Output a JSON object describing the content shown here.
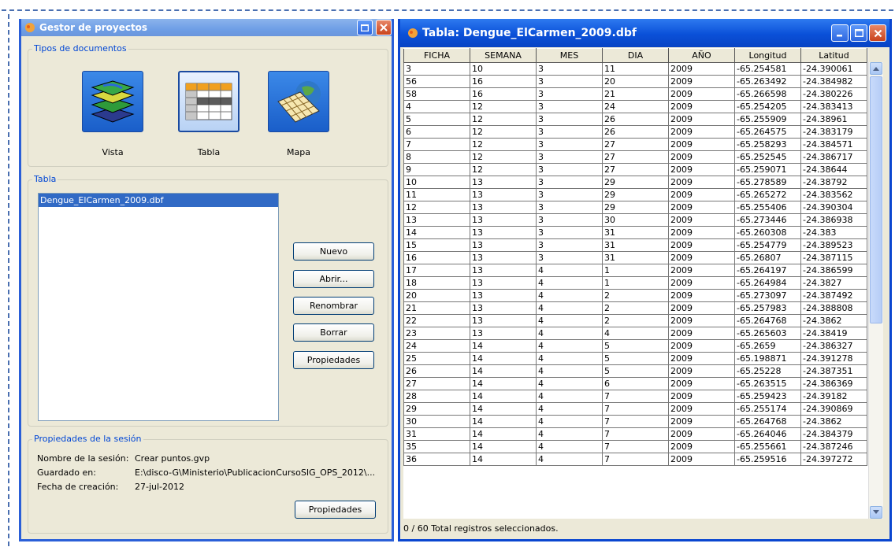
{
  "left_window": {
    "title": "Gestor de proyectos",
    "doc_types_legend": "Tipos de documentos",
    "doc_types": [
      {
        "label": "Vista",
        "icon": "vista-layers-icon"
      },
      {
        "label": "Tabla",
        "icon": "table-icon"
      },
      {
        "label": "Mapa",
        "icon": "map-icon"
      }
    ],
    "table_legend": "Tabla",
    "table_items": [
      "Dengue_ElCarmen_2009.dbf"
    ],
    "buttons": {
      "new": "Nuevo",
      "open": "Abrir...",
      "rename": "Renombrar",
      "delete": "Borrar",
      "properties": "Propiedades"
    },
    "session": {
      "legend": "Propiedades de la sesión",
      "name_label": "Nombre de la sesión:",
      "name_value": "Crear puntos.gvp",
      "saved_label": "Guardado en:",
      "saved_value": "E:\\disco-G\\Ministerio\\PublicacionCursoSIG_OPS_2012\\...",
      "date_label": "Fecha de creación:",
      "date_value": "27-jul-2012",
      "properties_button": "Propiedades"
    }
  },
  "right_window": {
    "title": "Tabla: Dengue_ElCarmen_2009.dbf",
    "columns": [
      "FICHA",
      "SEMANA",
      "MES",
      "DIA",
      "AÑO",
      "Longitud",
      "Latitud"
    ],
    "rows": [
      [
        "3",
        "10",
        "3",
        "11",
        "2009",
        "-65.254581",
        "-24.390061"
      ],
      [
        "56",
        "16",
        "3",
        "20",
        "2009",
        "-65.263492",
        "-24.384982"
      ],
      [
        "58",
        "16",
        "3",
        "21",
        "2009",
        "-65.266598",
        "-24.380226"
      ],
      [
        "4",
        "12",
        "3",
        "24",
        "2009",
        "-65.254205",
        "-24.383413"
      ],
      [
        "5",
        "12",
        "3",
        "26",
        "2009",
        "-65.255909",
        "-24.38961"
      ],
      [
        "6",
        "12",
        "3",
        "26",
        "2009",
        "-65.264575",
        "-24.383179"
      ],
      [
        "7",
        "12",
        "3",
        "27",
        "2009",
        "-65.258293",
        "-24.384571"
      ],
      [
        "8",
        "12",
        "3",
        "27",
        "2009",
        "-65.252545",
        "-24.386717"
      ],
      [
        "9",
        "12",
        "3",
        "27",
        "2009",
        "-65.259071",
        "-24.38644"
      ],
      [
        "10",
        "13",
        "3",
        "29",
        "2009",
        "-65.278589",
        "-24.38792"
      ],
      [
        "11",
        "13",
        "3",
        "29",
        "2009",
        "-65.265272",
        "-24.383562"
      ],
      [
        "12",
        "13",
        "3",
        "29",
        "2009",
        "-65.255406",
        "-24.390304"
      ],
      [
        "13",
        "13",
        "3",
        "30",
        "2009",
        "-65.273446",
        "-24.386938"
      ],
      [
        "14",
        "13",
        "3",
        "31",
        "2009",
        "-65.260308",
        "-24.383"
      ],
      [
        "15",
        "13",
        "3",
        "31",
        "2009",
        "-65.254779",
        "-24.389523"
      ],
      [
        "16",
        "13",
        "3",
        "31",
        "2009",
        "-65.26807",
        "-24.387115"
      ],
      [
        "17",
        "13",
        "4",
        "1",
        "2009",
        "-65.264197",
        "-24.386599"
      ],
      [
        "18",
        "13",
        "4",
        "1",
        "2009",
        "-65.264984",
        "-24.3827"
      ],
      [
        "20",
        "13",
        "4",
        "2",
        "2009",
        "-65.273097",
        "-24.387492"
      ],
      [
        "21",
        "13",
        "4",
        "2",
        "2009",
        "-65.257983",
        "-24.388808"
      ],
      [
        "22",
        "13",
        "4",
        "2",
        "2009",
        "-65.264768",
        "-24.3862"
      ],
      [
        "23",
        "13",
        "4",
        "4",
        "2009",
        "-65.265603",
        "-24.38419"
      ],
      [
        "24",
        "14",
        "4",
        "5",
        "2009",
        "-65.2659",
        "-24.386327"
      ],
      [
        "25",
        "14",
        "4",
        "5",
        "2009",
        "-65.198871",
        "-24.391278"
      ],
      [
        "26",
        "14",
        "4",
        "5",
        "2009",
        "-65.25228",
        "-24.387351"
      ],
      [
        "27",
        "14",
        "4",
        "6",
        "2009",
        "-65.263515",
        "-24.386369"
      ],
      [
        "28",
        "14",
        "4",
        "7",
        "2009",
        "-65.259423",
        "-24.39182"
      ],
      [
        "29",
        "14",
        "4",
        "7",
        "2009",
        "-65.255174",
        "-24.390869"
      ],
      [
        "30",
        "14",
        "4",
        "7",
        "2009",
        "-65.264768",
        "-24.3862"
      ],
      [
        "31",
        "14",
        "4",
        "7",
        "2009",
        "-65.264046",
        "-24.384379"
      ],
      [
        "35",
        "14",
        "4",
        "7",
        "2009",
        "-65.255661",
        "-24.387246"
      ],
      [
        "36",
        "14",
        "4",
        "7",
        "2009",
        "-65.259516",
        "-24.397272"
      ]
    ],
    "status": "0 / 60 Total registros seleccionados."
  },
  "colors": {
    "title_active": "#0a50d8",
    "title_inactive": "#7aa6e8",
    "selection": "#316ac5",
    "legend_text": "#0046d5"
  }
}
